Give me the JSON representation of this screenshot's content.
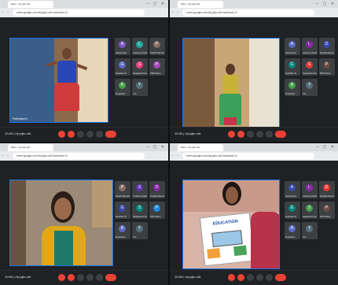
{
  "screenshots": [
    {
      "tab_title": "Meet - rfyi-jqtv-ubt",
      "url": "meet.google.com/rfyi-jqtv-ubt?authuser=0",
      "bottom_left": "10:40 | rfyi-jqtv-ubt",
      "speaker_label": "Participant 1",
      "tiles": [
        {
          "name": "Ananya Dev",
          "initial": "A",
          "color": "#7e57c2"
        },
        {
          "name": "Lavanya Chandran",
          "initial": "L",
          "color": "#26a69a"
        },
        {
          "name": "Preethi Ramesh",
          "initial": "P",
          "color": "#8d6e63"
        },
        {
          "name": "Gowtham R",
          "initial": "G",
          "color": "#5c6bc0"
        },
        {
          "name": "Sangeetha Kumar",
          "initial": "S",
          "color": "#ec407a"
        },
        {
          "name": "PRIYA Devi",
          "initial": "P",
          "color": "#ab47bc"
        },
        {
          "name": "R.Lakshmi",
          "initial": "R",
          "color": "#43a047"
        },
        {
          "name": "You",
          "initial": "Y",
          "color": "#546e7a"
        }
      ]
    },
    {
      "tab_title": "Meet - rfyi-jqtv-ubt",
      "url": "meet.google.com/rfyi-jqtv-ubt?authuser=0",
      "bottom_left": "10:45 | rfyi-jqtv-ubt",
      "speaker_label": "",
      "tiles": [
        {
          "name": "Ananya Dev",
          "initial": "A",
          "color": "#5c6bc0"
        },
        {
          "name": "Lavanya Chandran",
          "initial": "L",
          "color": "#8e24aa"
        },
        {
          "name": "Deepika Raman",
          "initial": "D",
          "color": "#3949ab"
        },
        {
          "name": "Gowtham R",
          "initial": "G",
          "color": "#00897b"
        },
        {
          "name": "Sangeetha Kumar",
          "initial": "S",
          "color": "#e53935"
        },
        {
          "name": "PRIYA Devi",
          "initial": "P",
          "color": "#6d4c41"
        },
        {
          "name": "R.Lakshmi",
          "initial": "R",
          "color": "#43a047"
        },
        {
          "name": "You",
          "initial": "Y",
          "color": "#546e7a"
        }
      ]
    },
    {
      "tab_title": "Meet - rfyi-jqtv-ubt",
      "url": "meet.google.com/rfyi-jqtv-ubt?authuser=0",
      "bottom_left": "10:50 | rfyi-jqtv-ubt",
      "speaker_label": "",
      "tiles": [
        {
          "name": "Preethi Ramesh",
          "initial": "P",
          "color": "#8d6e63"
        },
        {
          "name": "S.Vidhya Lakshmi",
          "initial": "S",
          "color": "#5e35b1"
        },
        {
          "name": "Deepika Raman",
          "initial": "D",
          "color": "#8e24aa"
        },
        {
          "name": "Gowtham R",
          "initial": "G",
          "color": "#3949ab"
        },
        {
          "name": "Sangeetha Kumar",
          "initial": "S",
          "color": "#00897b"
        },
        {
          "name": "PRIYA Devi",
          "initial": "P",
          "color": "#1e88e5"
        },
        {
          "name": "R.Lakshmi",
          "initial": "R",
          "color": "#5c6bc0"
        },
        {
          "name": "You",
          "initial": "Y",
          "color": "#546e7a"
        }
      ]
    },
    {
      "tab_title": "Meet - rfyi-jqtv-ubt",
      "url": "meet.google.com/rfyi-jqtv-ubt?authuser=0",
      "bottom_left": "10:55 | rfyi-jqtv-ubt",
      "speaker_label": "",
      "tiles": [
        {
          "name": "Ananya Dev",
          "initial": "A",
          "color": "#3949ab"
        },
        {
          "name": "Lavanya Chandran",
          "initial": "L",
          "color": "#8e24aa"
        },
        {
          "name": "Deepika Raman",
          "initial": "D",
          "color": "#e53935"
        },
        {
          "name": "Gowtham R",
          "initial": "G",
          "color": "#00897b"
        },
        {
          "name": "Sangeetha Kumar",
          "initial": "S",
          "color": "#43a047"
        },
        {
          "name": "PRIYA Devi",
          "initial": "P",
          "color": "#6d4c41"
        },
        {
          "name": "R.Lakshmi",
          "initial": "R",
          "color": "#5c6bc0"
        },
        {
          "name": "You",
          "initial": "Y",
          "color": "#546e7a"
        }
      ]
    }
  ],
  "drawing_caption": "EDUCATION",
  "accent": "#1a73e8"
}
